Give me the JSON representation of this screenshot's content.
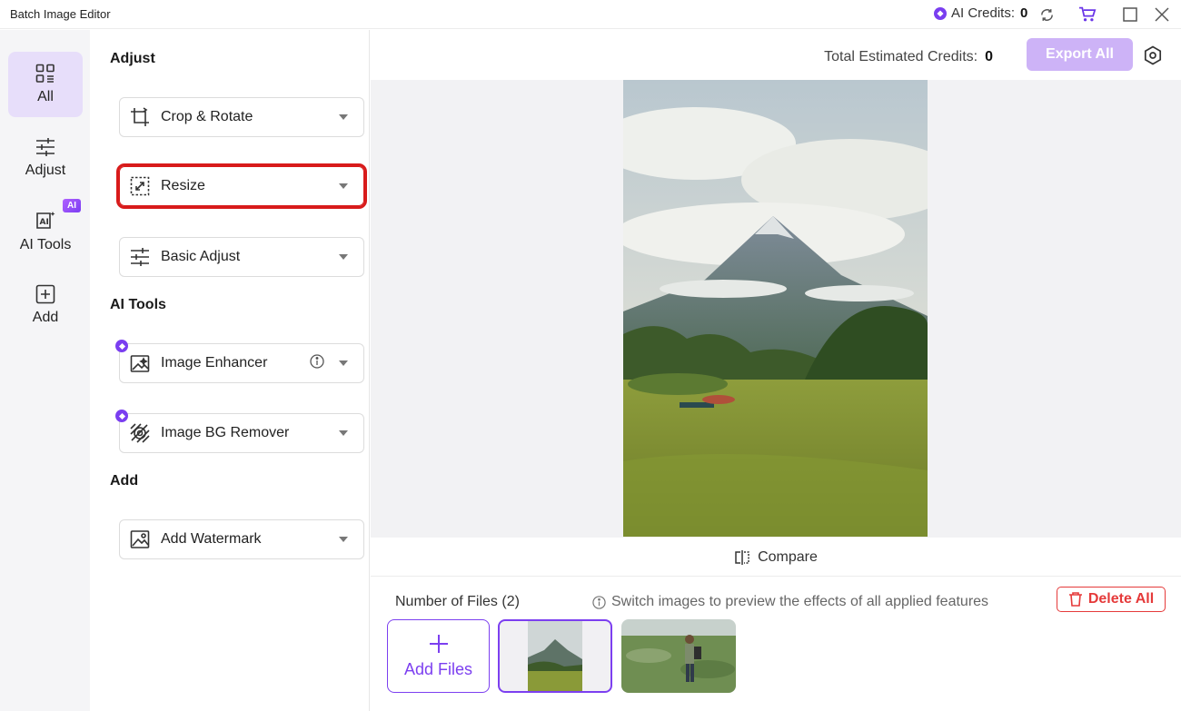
{
  "app": {
    "title": "Batch Image Editor"
  },
  "titlebar": {
    "ai_credits_label": "AI Credits:",
    "ai_credits_value": "0"
  },
  "rail": {
    "items": [
      {
        "label": "All",
        "icon": "grid-icon",
        "active": true
      },
      {
        "label": "Adjust",
        "icon": "sliders-icon",
        "active": false
      },
      {
        "label": "AI Tools",
        "icon": "ai-tools-icon",
        "active": false
      },
      {
        "label": "Add",
        "icon": "plus-square-icon",
        "active": false
      }
    ],
    "ai_badge": "AI"
  },
  "panel": {
    "sections": {
      "adjust": "Adjust",
      "ai_tools": "AI Tools",
      "add": "Add"
    },
    "features": {
      "crop": "Crop & Rotate",
      "resize": "Resize",
      "basic_adjust": "Basic Adjust",
      "image_enhancer": "Image Enhancer",
      "bg_remover": "Image BG Remover",
      "watermark": "Add Watermark"
    }
  },
  "main": {
    "total_credits_label": "Total Estimated Credits:",
    "total_credits_value": "0",
    "export_label": "Export All",
    "compare_label": "Compare",
    "files_count": "Number of Files (2)",
    "files_hint": "Switch images to preview the effects of all applied features",
    "delete_all": "Delete All",
    "add_files": "Add Files"
  },
  "colors": {
    "accent": "#7c3ff0",
    "export_disabled": "#cdb3f7",
    "highlight": "#d81b1b",
    "danger": "#e53a3a"
  }
}
